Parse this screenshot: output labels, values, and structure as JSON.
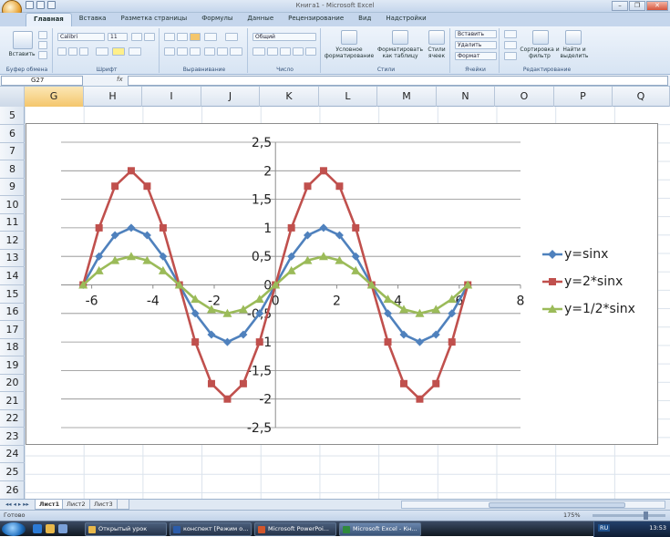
{
  "window": {
    "title": "Книга1 - Microsoft Excel",
    "controls": {
      "minimize": "–",
      "restore": "❐",
      "close": "✕"
    }
  },
  "ribbon_tabs": [
    "Главная",
    "Вставка",
    "Разметка страницы",
    "Формулы",
    "Данные",
    "Рецензирование",
    "Вид",
    "Надстройки"
  ],
  "ribbon": {
    "clipboard": {
      "paste": "Вставить",
      "label": "Буфер обмена"
    },
    "font": {
      "name": "Calibri",
      "size": "11",
      "label": "Шрифт"
    },
    "alignment": {
      "label": "Выравнивание"
    },
    "number": {
      "format": "Общий",
      "label": "Число"
    },
    "styles": {
      "cond": "Условное форматирование",
      "table": "Форматировать как таблицу",
      "cell": "Стили ячеек",
      "label": "Стили"
    },
    "cells": {
      "insert": "Вставить",
      "delete": "Удалить",
      "format": "Формат",
      "label": "Ячейки"
    },
    "editing": {
      "sort": "Сортировка и фильтр",
      "find": "Найти и выделить",
      "label": "Редактирование"
    }
  },
  "formula_bar": {
    "name_box": "G27",
    "fx": "fx",
    "content": ""
  },
  "columns": [
    "G",
    "H",
    "I",
    "J",
    "K",
    "L",
    "M",
    "N",
    "O",
    "P",
    "Q"
  ],
  "selected_column": "G",
  "rows": [
    "5",
    "6",
    "7",
    "8",
    "9",
    "10",
    "11",
    "12",
    "13",
    "14",
    "15",
    "16",
    "17",
    "18",
    "19",
    "20",
    "21",
    "22",
    "23",
    "24",
    "25",
    "26"
  ],
  "chart_data": {
    "type": "line",
    "x": [
      -6.28,
      -5.76,
      -5.24,
      -4.71,
      -4.19,
      -3.67,
      -3.14,
      -2.62,
      -2.09,
      -1.57,
      -1.05,
      -0.52,
      0,
      0.52,
      1.05,
      1.57,
      2.09,
      2.62,
      3.14,
      3.67,
      4.19,
      4.71,
      5.24,
      5.76,
      6.28
    ],
    "series": [
      {
        "name": "y=sinx",
        "color": "#4f81bd",
        "marker": "diamond",
        "values": [
          0,
          0.5,
          0.87,
          1,
          0.87,
          0.5,
          0,
          -0.5,
          -0.87,
          -1,
          -0.87,
          -0.5,
          0,
          0.5,
          0.87,
          1,
          0.87,
          0.5,
          0,
          -0.5,
          -0.87,
          -1,
          -0.87,
          -0.5,
          0
        ]
      },
      {
        "name": "y=2*sinx",
        "color": "#c0504d",
        "marker": "square",
        "values": [
          0,
          1,
          1.73,
          2,
          1.73,
          1,
          0,
          -1,
          -1.73,
          -2,
          -1.73,
          -1,
          0,
          1,
          1.73,
          2,
          1.73,
          1,
          0,
          -1,
          -1.73,
          -2,
          -1.73,
          -1,
          0
        ]
      },
      {
        "name": "y=1/2*sinx",
        "color": "#9bbb59",
        "marker": "triangle",
        "values": [
          0,
          0.25,
          0.43,
          0.5,
          0.43,
          0.25,
          0,
          -0.25,
          -0.43,
          -0.5,
          -0.43,
          -0.25,
          0,
          0.25,
          0.43,
          0.5,
          0.43,
          0.25,
          0,
          -0.25,
          -0.43,
          -0.5,
          -0.43,
          -0.25,
          0
        ]
      }
    ],
    "xlim": [
      -7,
      8
    ],
    "ylim": [
      -2.5,
      2.5
    ],
    "xticks": [
      "-6",
      "-4",
      "-2",
      "0",
      "2",
      "4",
      "6",
      "8"
    ],
    "yticks": [
      "2,5",
      "2",
      "1,5",
      "1",
      "0,5",
      "0",
      "-0,5",
      "-1",
      "-1,5",
      "-2",
      "-2,5"
    ],
    "grid": "horizontal",
    "legend": "right"
  },
  "sheet_tabs": [
    "Лист1",
    "Лист2",
    "Лист3"
  ],
  "status": {
    "text": "Готово",
    "zoom": "175%"
  },
  "taskbar": {
    "items": [
      "Открытый урок",
      "конспект [Режим о...",
      "Microsoft PowerPoi...",
      "Microsoft Excel - Кн..."
    ],
    "lang": "RU",
    "clock": "13:53"
  }
}
